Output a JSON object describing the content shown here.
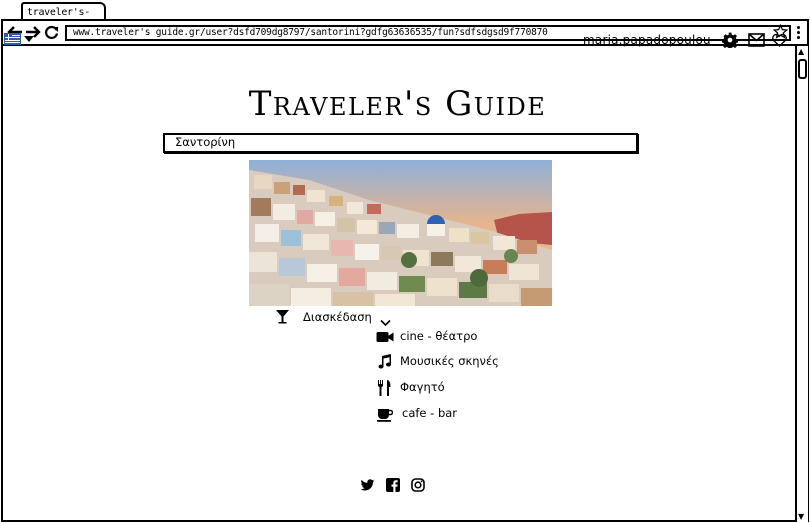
{
  "browser": {
    "tab_title": "traveler's-guide",
    "url": "www.traveler's guide.gr/user?dsfd709dg8797/santorini?gdfg63636535/fun?sdfsdgsd9f770870"
  },
  "header": {
    "language_flag": "greek-flag-icon",
    "username": "maria.papadopoulou",
    "icons": [
      "gear-icon",
      "mail-icon",
      "heart-icon"
    ]
  },
  "main": {
    "title": "Traveler's Guide",
    "search": {
      "value": "Σαντορίνη"
    },
    "category": {
      "icon": "cocktail-icon",
      "label": "Διασκέδαση"
    },
    "subcategories": [
      {
        "icon": "video-camera-icon",
        "label": "cine - θέατρο"
      },
      {
        "icon": "music-note-icon",
        "label": "Μουσικές σκηνές"
      },
      {
        "icon": "utensils-icon",
        "label": "Φαγητό"
      },
      {
        "icon": "coffee-cup-icon",
        "label": "cafe - bar"
      }
    ]
  },
  "footer": {
    "social": [
      "twitter-icon",
      "facebook-icon",
      "instagram-icon"
    ]
  }
}
